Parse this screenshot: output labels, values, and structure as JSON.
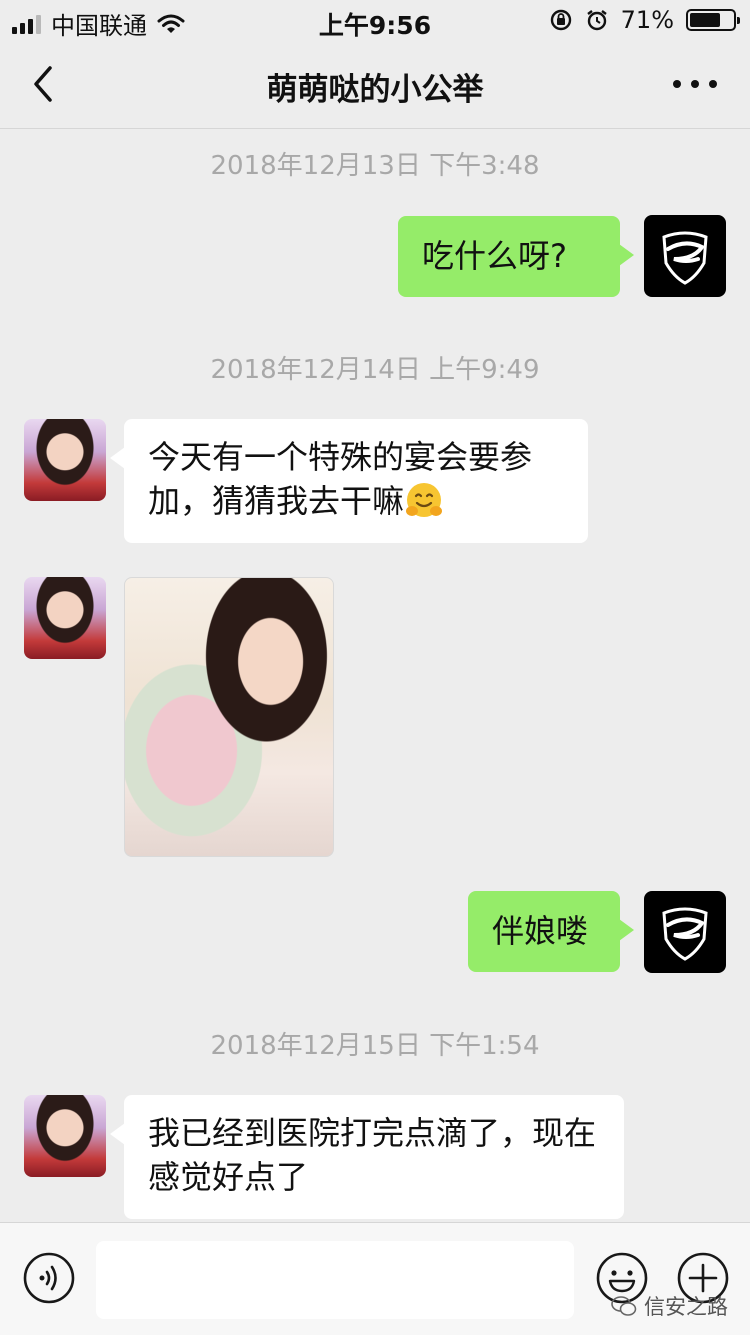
{
  "status_bar": {
    "carrier": "中国联通",
    "time": "上午9:56",
    "battery_text": "71%",
    "battery_level": 0.71
  },
  "header": {
    "title": "萌萌哒的小公举"
  },
  "messages": [
    {
      "type": "timestamp",
      "text": "2018年12月13日 下午3:48"
    },
    {
      "type": "text",
      "sender": "me",
      "text": "吃什么呀?"
    },
    {
      "type": "timestamp",
      "text": "2018年12月14日 上午9:49"
    },
    {
      "type": "text",
      "sender": "her",
      "text": "今天有一个特殊的宴会要参加，猜猜我去干嘛",
      "emoji": "hugging-face"
    },
    {
      "type": "image",
      "sender": "her"
    },
    {
      "type": "text",
      "sender": "me",
      "text": "伴娘喽"
    },
    {
      "type": "timestamp",
      "text": "2018年12月15日 下午1:54"
    },
    {
      "type": "text",
      "sender": "her",
      "text": "我已经到医院打完点滴了，现在感觉好点了"
    }
  ],
  "input_bar": {
    "value": "",
    "icons": [
      "voice-icon",
      "emoji-icon",
      "plus-icon"
    ]
  },
  "watermark": {
    "text": "信安之路"
  },
  "colors": {
    "background": "#ededed",
    "my_bubble": "#95ec69",
    "her_bubble": "#ffffff",
    "timestamp": "#a8a8a8"
  }
}
